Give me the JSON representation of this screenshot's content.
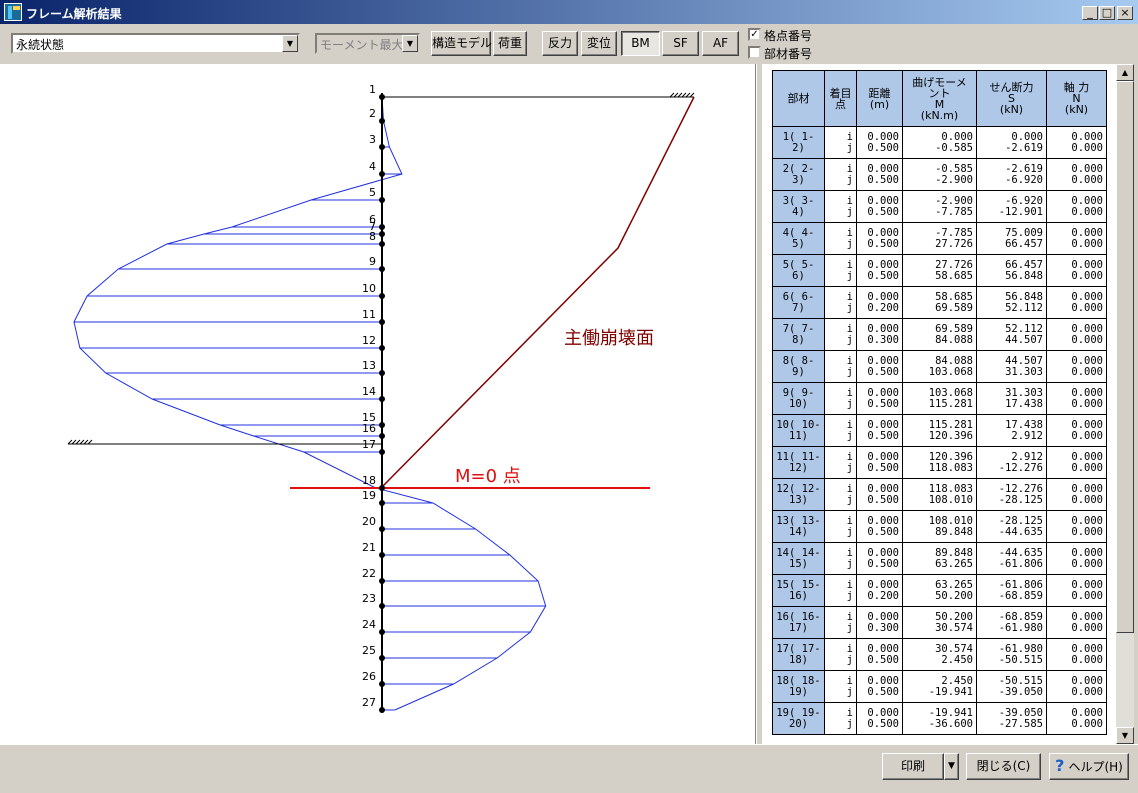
{
  "window": {
    "title": "フレーム解析結果",
    "minimize": "_",
    "maximize": "□",
    "close": "×"
  },
  "toolbar": {
    "state_select": "永続状態",
    "mode_select": "モーメント最大",
    "buttons": [
      {
        "label": "構造モデル"
      },
      {
        "label": "荷重"
      },
      {
        "label": "反力"
      },
      {
        "label": "変位"
      },
      {
        "label": "BM",
        "pressed": true
      },
      {
        "label": "SF"
      },
      {
        "label": "AF"
      }
    ],
    "checkboxes": [
      {
        "label": "格点番号",
        "checked": true
      },
      {
        "label": "部材番号",
        "checked": false
      }
    ]
  },
  "diagram": {
    "node_labels": [
      "1",
      "2",
      "3",
      "4",
      "5",
      "6",
      "7",
      "8",
      "9",
      "10",
      "11",
      "12",
      "13",
      "14",
      "15",
      "16",
      "17",
      "18",
      "19",
      "20",
      "21",
      "22",
      "23",
      "24",
      "25",
      "26",
      "27"
    ],
    "annotation_failure": "主働崩壊面",
    "annotation_zero": "M=0 点",
    "colors": {
      "moment": "#2030e0",
      "failure_plane": "#800000",
      "zero_line": "#e01010"
    }
  },
  "table": {
    "headers": {
      "member": "部材",
      "point": [
        "着目",
        "点"
      ],
      "distance": [
        "距離",
        "(m)"
      ],
      "moment": [
        "曲げモーメ",
        "ント",
        "M",
        "(kN.m)"
      ],
      "shear": [
        "せん断力",
        "S",
        "(kN)"
      ],
      "axial": [
        "軸 力",
        "N",
        "(kN)"
      ]
    },
    "rows": [
      {
        "m1": "1( 1-",
        "m2": "2)",
        "d": [
          "0.000",
          "0.500"
        ],
        "M": [
          "0.000",
          "-0.585"
        ],
        "S": [
          "0.000",
          "-2.619"
        ],
        "N": [
          "0.000",
          "0.000"
        ]
      },
      {
        "m1": "2( 2-",
        "m2": "3)",
        "d": [
          "0.000",
          "0.500"
        ],
        "M": [
          "-0.585",
          "-2.900"
        ],
        "S": [
          "-2.619",
          "-6.920"
        ],
        "N": [
          "0.000",
          "0.000"
        ]
      },
      {
        "m1": "3( 3-",
        "m2": "4)",
        "d": [
          "0.000",
          "0.500"
        ],
        "M": [
          "-2.900",
          "-7.785"
        ],
        "S": [
          "-6.920",
          "-12.901"
        ],
        "N": [
          "0.000",
          "0.000"
        ]
      },
      {
        "m1": "4( 4-",
        "m2": "5)",
        "d": [
          "0.000",
          "0.500"
        ],
        "M": [
          "-7.785",
          "27.726"
        ],
        "S": [
          "75.009",
          "66.457"
        ],
        "N": [
          "0.000",
          "0.000"
        ]
      },
      {
        "m1": "5( 5-",
        "m2": "6)",
        "d": [
          "0.000",
          "0.500"
        ],
        "M": [
          "27.726",
          "58.685"
        ],
        "S": [
          "66.457",
          "56.848"
        ],
        "N": [
          "0.000",
          "0.000"
        ]
      },
      {
        "m1": "6( 6-",
        "m2": "7)",
        "d": [
          "0.000",
          "0.200"
        ],
        "M": [
          "58.685",
          "69.589"
        ],
        "S": [
          "56.848",
          "52.112"
        ],
        "N": [
          "0.000",
          "0.000"
        ]
      },
      {
        "m1": "7( 7-",
        "m2": "8)",
        "d": [
          "0.000",
          "0.300"
        ],
        "M": [
          "69.589",
          "84.088"
        ],
        "S": [
          "52.112",
          "44.507"
        ],
        "N": [
          "0.000",
          "0.000"
        ]
      },
      {
        "m1": "8( 8-",
        "m2": "9)",
        "d": [
          "0.000",
          "0.500"
        ],
        "M": [
          "84.088",
          "103.068"
        ],
        "S": [
          "44.507",
          "31.303"
        ],
        "N": [
          "0.000",
          "0.000"
        ]
      },
      {
        "m1": "9( 9-",
        "m2": "10)",
        "d": [
          "0.000",
          "0.500"
        ],
        "M": [
          "103.068",
          "115.281"
        ],
        "S": [
          "31.303",
          "17.438"
        ],
        "N": [
          "0.000",
          "0.000"
        ]
      },
      {
        "m1": "10( 10-",
        "m2": "11)",
        "d": [
          "0.000",
          "0.500"
        ],
        "M": [
          "115.281",
          "120.396"
        ],
        "S": [
          "17.438",
          "2.912"
        ],
        "N": [
          "0.000",
          "0.000"
        ]
      },
      {
        "m1": "11( 11-",
        "m2": "12)",
        "d": [
          "0.000",
          "0.500"
        ],
        "M": [
          "120.396",
          "118.083"
        ],
        "S": [
          "2.912",
          "-12.276"
        ],
        "N": [
          "0.000",
          "0.000"
        ]
      },
      {
        "m1": "12( 12-",
        "m2": "13)",
        "d": [
          "0.000",
          "0.500"
        ],
        "M": [
          "118.083",
          "108.010"
        ],
        "S": [
          "-12.276",
          "-28.125"
        ],
        "N": [
          "0.000",
          "0.000"
        ]
      },
      {
        "m1": "13( 13-",
        "m2": "14)",
        "d": [
          "0.000",
          "0.500"
        ],
        "M": [
          "108.010",
          "89.848"
        ],
        "S": [
          "-28.125",
          "-44.635"
        ],
        "N": [
          "0.000",
          "0.000"
        ]
      },
      {
        "m1": "14( 14-",
        "m2": "15)",
        "d": [
          "0.000",
          "0.500"
        ],
        "M": [
          "89.848",
          "63.265"
        ],
        "S": [
          "-44.635",
          "-61.806"
        ],
        "N": [
          "0.000",
          "0.000"
        ]
      },
      {
        "m1": "15( 15-",
        "m2": "16)",
        "d": [
          "0.000",
          "0.200"
        ],
        "M": [
          "63.265",
          "50.200"
        ],
        "S": [
          "-61.806",
          "-68.859"
        ],
        "N": [
          "0.000",
          "0.000"
        ]
      },
      {
        "m1": "16( 16-",
        "m2": "17)",
        "d": [
          "0.000",
          "0.300"
        ],
        "M": [
          "50.200",
          "30.574"
        ],
        "S": [
          "-68.859",
          "-61.980"
        ],
        "N": [
          "0.000",
          "0.000"
        ]
      },
      {
        "m1": "17( 17-",
        "m2": "18)",
        "d": [
          "0.000",
          "0.500"
        ],
        "M": [
          "30.574",
          "2.450"
        ],
        "S": [
          "-61.980",
          "-50.515"
        ],
        "N": [
          "0.000",
          "0.000"
        ]
      },
      {
        "m1": "18( 18-",
        "m2": "19)",
        "d": [
          "0.000",
          "0.500"
        ],
        "M": [
          "2.450",
          "-19.941"
        ],
        "S": [
          "-50.515",
          "-39.050"
        ],
        "N": [
          "0.000",
          "0.000"
        ]
      },
      {
        "m1": "19( 19-",
        "m2": "20)",
        "d": [
          "0.000",
          "0.500"
        ],
        "M": [
          "-19.941",
          "-36.600"
        ],
        "S": [
          "-39.050",
          "-27.585"
        ],
        "N": [
          "0.000",
          "0.000"
        ]
      }
    ],
    "point_labels": [
      "i",
      "j"
    ]
  },
  "footer": {
    "print": "印刷",
    "print_arrow": "▼",
    "close": "閉じる(C)",
    "help_icon": "?",
    "help": "ヘルプ(H)"
  }
}
